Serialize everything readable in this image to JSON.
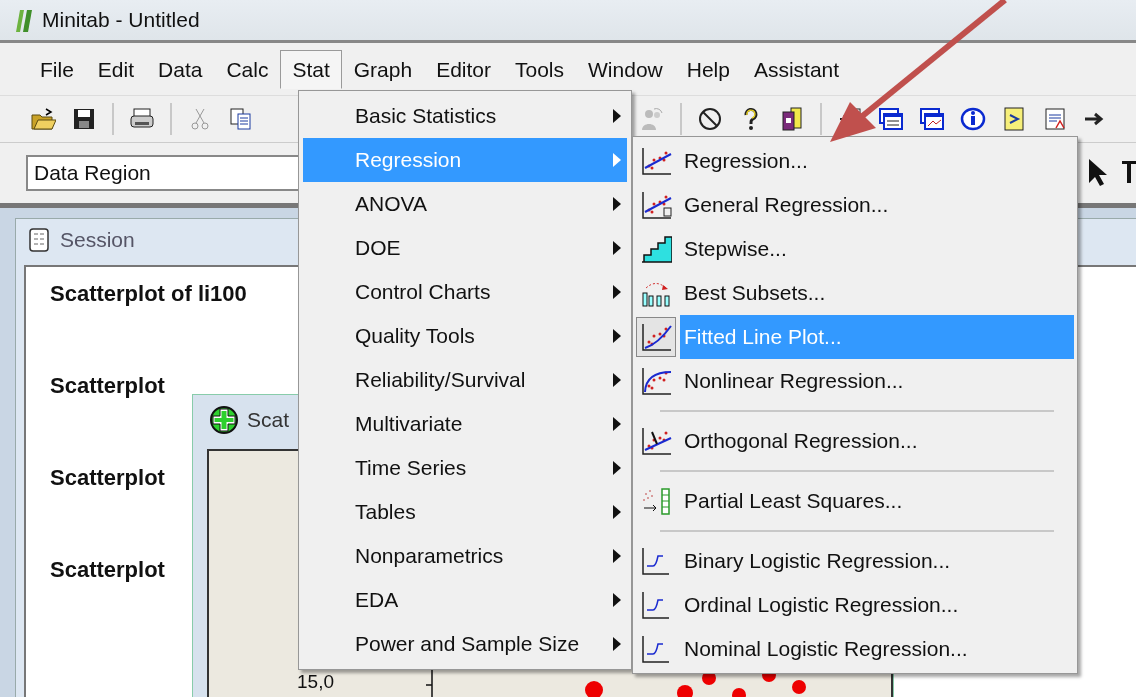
{
  "window": {
    "title": "Minitab - Untitled"
  },
  "menubar": [
    {
      "label": "File",
      "selected": false
    },
    {
      "label": "Edit",
      "selected": false
    },
    {
      "label": "Data",
      "selected": false
    },
    {
      "label": "Calc",
      "selected": false
    },
    {
      "label": "Stat",
      "selected": true
    },
    {
      "label": "Graph",
      "selected": false
    },
    {
      "label": "Editor",
      "selected": false
    },
    {
      "label": "Tools",
      "selected": false
    },
    {
      "label": "Window",
      "selected": false
    },
    {
      "label": "Help",
      "selected": false
    },
    {
      "label": "Assistant",
      "selected": false
    }
  ],
  "format_toolbar": {
    "region": "Data Region"
  },
  "session": {
    "title": "Session",
    "lines": [
      "Scatterplot of li100",
      "Scatterplot",
      "Scatterplot",
      "Scatterplot"
    ]
  },
  "graph_window": {
    "title": "Scat",
    "tick_label": "15,0"
  },
  "stat_menu": [
    {
      "label": "Basic Statistics",
      "selected": false
    },
    {
      "label": "Regression",
      "selected": true
    },
    {
      "label": "ANOVA",
      "selected": false
    },
    {
      "label": "DOE",
      "selected": false
    },
    {
      "label": "Control Charts",
      "selected": false
    },
    {
      "label": "Quality Tools",
      "selected": false
    },
    {
      "label": "Reliability/Survival",
      "selected": false
    },
    {
      "label": "Multivariate",
      "selected": false
    },
    {
      "label": "Time Series",
      "selected": false
    },
    {
      "label": "Tables",
      "selected": false
    },
    {
      "label": "Nonparametrics",
      "selected": false
    },
    {
      "label": "EDA",
      "selected": false
    },
    {
      "label": "Power and Sample Size",
      "selected": false
    }
  ],
  "regression_menu": [
    {
      "kind": "scatter-line",
      "label": "Regression...",
      "selected": false
    },
    {
      "kind": "scatter-general",
      "label": "General Regression...",
      "selected": false
    },
    {
      "kind": "stairs",
      "label": "Stepwise...",
      "selected": false
    },
    {
      "kind": "subsets",
      "label": "Best Subsets...",
      "selected": false
    },
    {
      "kind": "scatter-curve",
      "label": "Fitted Line Plot...",
      "selected": true
    },
    {
      "kind": "nonlinear",
      "label": "Nonlinear Regression...",
      "selected": false
    },
    {
      "kind": "separator"
    },
    {
      "kind": "orthogonal",
      "label": "Orthogonal Regression...",
      "selected": false
    },
    {
      "kind": "separator"
    },
    {
      "kind": "pls",
      "label": "Partial Least Squares...",
      "selected": false
    },
    {
      "kind": "separator"
    },
    {
      "kind": "logistic",
      "label": "Binary Logistic Regression...",
      "selected": false
    },
    {
      "kind": "logistic",
      "label": "Ordinal Logistic Regression...",
      "selected": false
    },
    {
      "kind": "logistic",
      "label": "Nominal Logistic Regression...",
      "selected": false
    }
  ]
}
